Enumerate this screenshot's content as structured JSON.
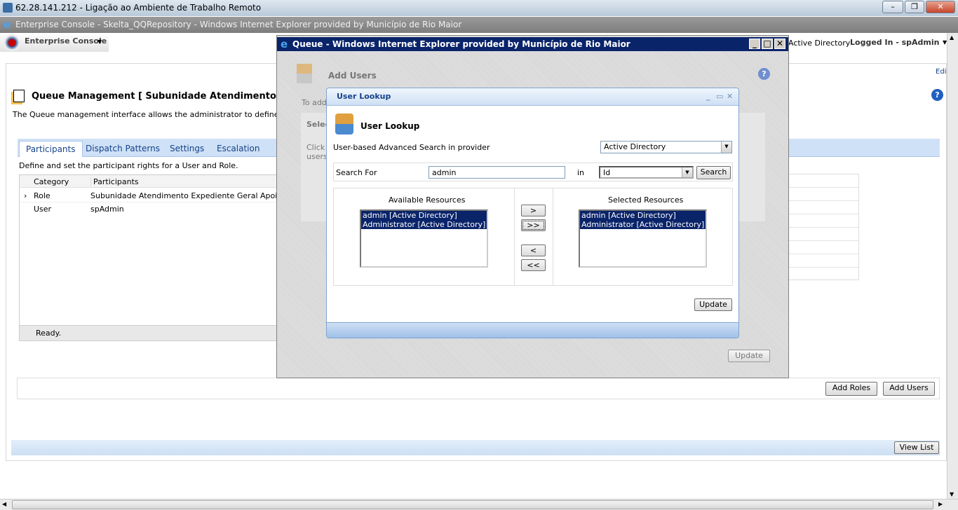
{
  "rdp": {
    "title": "62.28.141.212 - Ligação ao Ambiente de Trabalho Remoto"
  },
  "ie": {
    "title": "Enterprise Console - Skelta_QQRepository - Windows Internet Explorer provided by Município de Rio Maior"
  },
  "app": {
    "menu": "Enterprise Console",
    "provider": "Active Directory",
    "logged_in": "Logged In - spAdmin",
    "edit": "Edi"
  },
  "page": {
    "title": "Queue Management [ Subunidade Atendimento Expedie",
    "description": "The Queue management interface allows the administrator to define the",
    "tabs": [
      {
        "label": "Participants"
      },
      {
        "label": "Dispatch Patterns"
      },
      {
        "label": "Settings"
      },
      {
        "label": "Escalation"
      }
    ],
    "tab_description": "Define and set the participant rights for a User and Role.",
    "columns": [
      "Category",
      "Participants"
    ],
    "rows": [
      {
        "category": "Role",
        "participants": "Subunidade Atendimento Expediente Geral Apoio C"
      },
      {
        "category": "User",
        "participants": "spAdmin"
      }
    ],
    "status": "Ready.",
    "add_roles": "Add Roles",
    "add_users": "Add Users",
    "view_list": "View List"
  },
  "queue_window": {
    "title": "Queue - Windows Internet Explorer provided by Município de Rio Maior",
    "heading": "Add Users",
    "intro": "To add",
    "select_label": "Selec",
    "click_text": "Click",
    "users_text": "users",
    "update": "Update"
  },
  "lookup": {
    "header": "User Lookup",
    "title": "User Lookup",
    "provider_label": "User-based Advanced Search in provider",
    "provider_value": "Active Directory",
    "search_for_label": "Search For",
    "search_value": "admin",
    "in_label": "in",
    "field_value": "Id",
    "search_button": "Search",
    "available_label": "Available Resources",
    "selected_label": "Selected Resources",
    "available": [
      "admin [Active Directory]",
      "Administrator [Active Directory]"
    ],
    "selected": [
      "admin [Active Directory]",
      "Administrator [Active Directory]"
    ],
    "move_right": ">",
    "move_all_right": ">>",
    "move_left": "<",
    "move_all_left": "<<",
    "update": "Update"
  },
  "colors": {
    "titlebar_active": "#0a246a",
    "tab_bar": "#cfe1f6",
    "selection": "#0a246a"
  }
}
